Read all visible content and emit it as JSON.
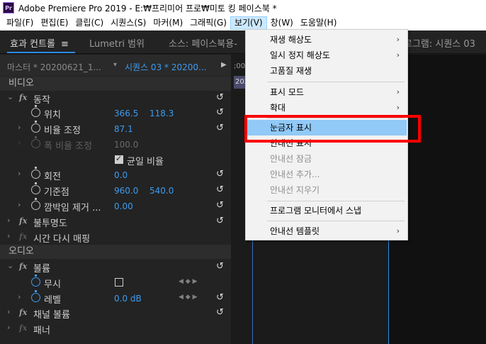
{
  "window": {
    "title": "Adobe Premiere Pro 2019 - E:₩프리미어 프로₩미토 킹 페이스북 *",
    "icon_text": "Pr"
  },
  "menubar": [
    "파일(F)",
    "편집(E)",
    "클립(C)",
    "시퀀스(S)",
    "마커(M)",
    "그래픽(G)",
    "보기(V)",
    "창(W)",
    "도움말(H)"
  ],
  "panel_tabs": {
    "effect_controls": "효과 컨트롤",
    "lumetri": "Lumetri 범위",
    "source": "소스: 페이스북용-",
    "program": "로그램: 시퀀스 03"
  },
  "effect_controls": {
    "master": "마스터 * 20200621_1...",
    "sequence": "시퀀스 03 * 20200...",
    "sections": {
      "video": "비디오",
      "audio": "오디오"
    },
    "motion": "동작",
    "position": {
      "label": "위치",
      "x": "366.5",
      "y": "118.3"
    },
    "scale": {
      "label": "비율 조정",
      "value": "87.1"
    },
    "scale_width": {
      "label": "폭 비율 조정",
      "value": "100.0"
    },
    "uniform": "균일 비율",
    "rotation": {
      "label": "회전",
      "value": "0.0"
    },
    "anchor": {
      "label": "기준점",
      "x": "960.0",
      "y": "540.0"
    },
    "flicker": {
      "label": "깜박임 제거 ...",
      "value": "0.00"
    },
    "opacity": "불투명도",
    "time_remap": "시간 다시 매핑",
    "volume": "볼륨",
    "bypass": "무시",
    "level": {
      "label": "레벨",
      "value": "0.0 dB"
    },
    "channel_volume": "채널 볼륨",
    "panner": "패너"
  },
  "timeline": {
    "timecode": ";00;",
    "clip": "202"
  },
  "view_menu": {
    "items": [
      {
        "label": "재생 해상도",
        "submenu": true,
        "enabled": true
      },
      {
        "label": "일시 정지 해상도",
        "submenu": true,
        "enabled": true
      },
      {
        "label": "고품질 재생",
        "submenu": false,
        "enabled": true
      },
      {
        "label": "표시 모드",
        "submenu": true,
        "enabled": true
      },
      {
        "label": "확대",
        "submenu": true,
        "enabled": true
      },
      {
        "label": "눈금자 표시",
        "submenu": false,
        "enabled": true,
        "highlighted": true
      },
      {
        "label": "안내선 표시",
        "submenu": false,
        "enabled": true
      },
      {
        "label": "안내선 잠금",
        "submenu": false,
        "enabled": false
      },
      {
        "label": "안내선 추가...",
        "submenu": false,
        "enabled": false
      },
      {
        "label": "안내선 지우기",
        "submenu": false,
        "enabled": false
      },
      {
        "label": "프로그램 모니터에서 스냅",
        "submenu": false,
        "enabled": true
      },
      {
        "label": "안내선 템플릿",
        "submenu": true,
        "enabled": true
      }
    ]
  },
  "colors": {
    "accent": "#3c9bf0",
    "highlight": "#91c9f7",
    "annotation": "#ff0000"
  }
}
